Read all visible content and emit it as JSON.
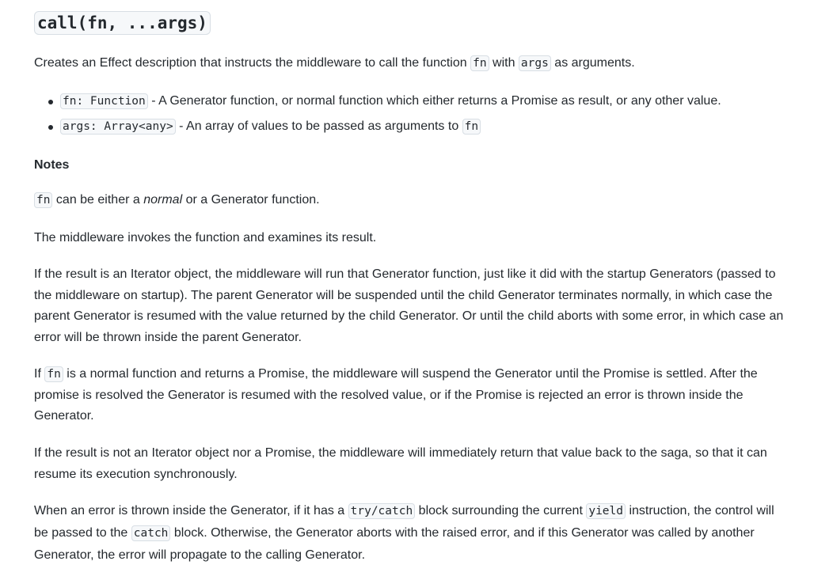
{
  "title": "call(fn, ...args)",
  "intro": {
    "t1": "Creates an Effect description that instructs the middleware to call the function ",
    "c1": "fn",
    "t2": " with ",
    "c2": "args",
    "t3": " as arguments."
  },
  "params": [
    {
      "code": "fn: Function",
      "text": " - A Generator function, or normal function which either returns a Promise as result, or any other value."
    },
    {
      "code": "args: Array<any>",
      "text": " - An array of values to be passed as arguments to ",
      "code2": "fn"
    }
  ],
  "notes_heading": "Notes",
  "note1": {
    "c1": "fn",
    "t1": " can be either a ",
    "em": "normal",
    "t2": " or a Generator function."
  },
  "note2": "The middleware invokes the function and examines its result.",
  "note3": "If the result is an Iterator object, the middleware will run that Generator function, just like it did with the startup Generators (passed to the middleware on startup). The parent Generator will be suspended until the child Generator terminates normally, in which case the parent Generator is resumed with the value returned by the child Generator. Or until the child aborts with some error, in which case an error will be thrown inside the parent Generator.",
  "note4": {
    "t1": "If ",
    "c1": "fn",
    "t2": " is a normal function and returns a Promise, the middleware will suspend the Generator until the Promise is settled. After the promise is resolved the Generator is resumed with the resolved value, or if the Promise is rejected an error is thrown inside the Generator."
  },
  "note5": "If the result is not an Iterator object nor a Promise, the middleware will immediately return that value back to the saga, so that it can resume its execution synchronously.",
  "note6": {
    "t1": "When an error is thrown inside the Generator, if it has a ",
    "c1": "try/catch",
    "t2": " block surrounding the current ",
    "c2": "yield",
    "t3": " instruction, the control will be passed to the ",
    "c3": "catch",
    "t4": " block. Otherwise, the Generator aborts with the raised error, and if this Generator was called by another Generator, the error will propagate to the calling Generator."
  }
}
